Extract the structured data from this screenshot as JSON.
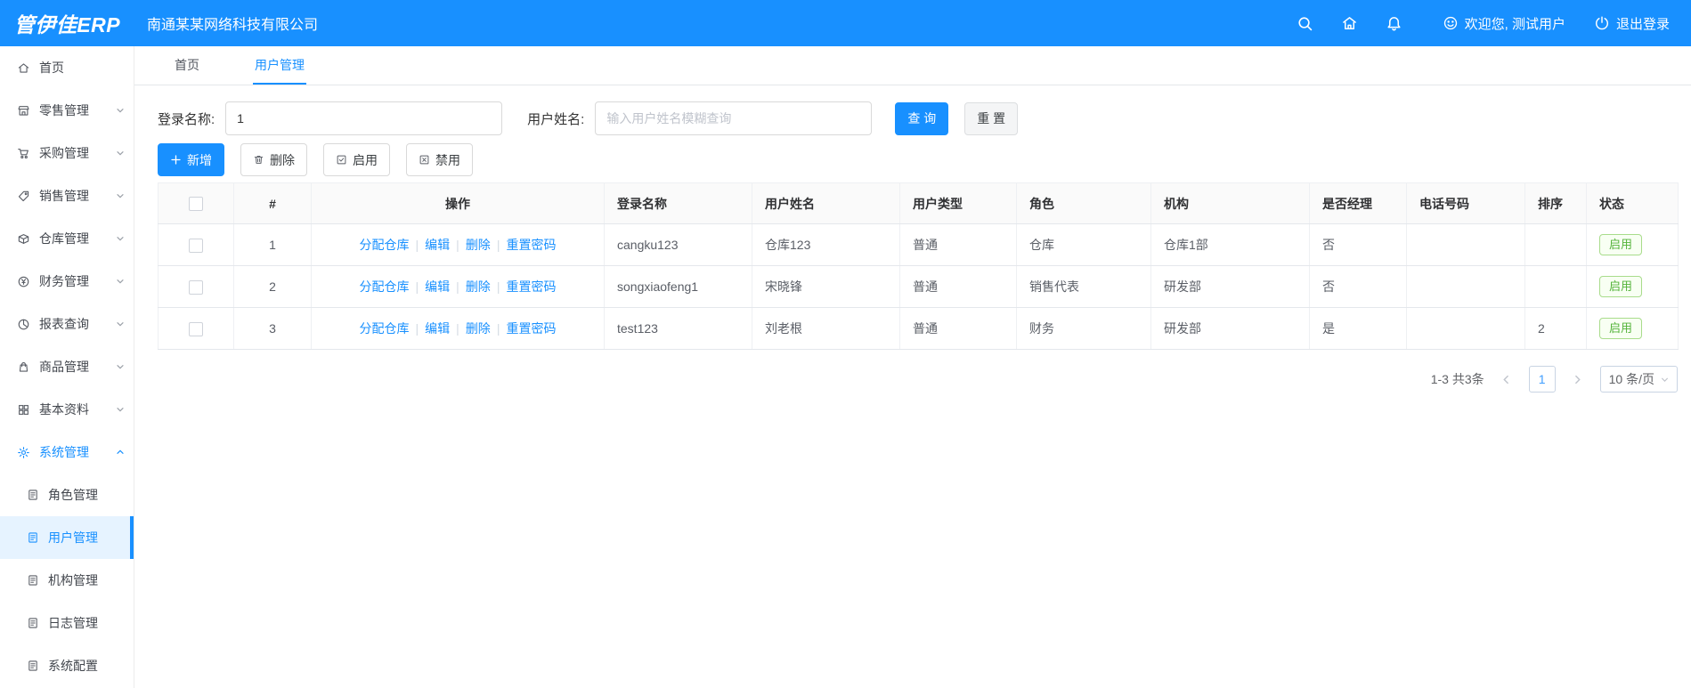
{
  "colors": {
    "primary": "#1890ff",
    "header_bg": "#1890ff",
    "success_green": "#54b33a",
    "active_menu_bg": "#e6f3ff"
  },
  "header": {
    "logo": "管伊佳ERP",
    "company": "南通某某网络科技有限公司",
    "welcome": "欢迎您, 测试用户",
    "logout": "退出登录"
  },
  "sidebar": {
    "items": [
      {
        "label": "首页"
      },
      {
        "label": "零售管理"
      },
      {
        "label": "采购管理"
      },
      {
        "label": "销售管理"
      },
      {
        "label": "仓库管理"
      },
      {
        "label": "财务管理"
      },
      {
        "label": "报表查询"
      },
      {
        "label": "商品管理"
      },
      {
        "label": "基本资料"
      },
      {
        "label": "系统管理"
      },
      {
        "label": "角色管理"
      },
      {
        "label": "用户管理"
      },
      {
        "label": "机构管理"
      },
      {
        "label": "日志管理"
      },
      {
        "label": "系统配置"
      }
    ]
  },
  "tabs": {
    "home": "首页",
    "user_management": "用户管理"
  },
  "search": {
    "login_label": "登录名称:",
    "login_value": "1",
    "name_label": "用户姓名:",
    "name_placeholder": "输入用户姓名模糊查询",
    "query_label": "查 询",
    "reset_label": "重 置"
  },
  "toolbar": {
    "add_label": "新增",
    "delete_label": "删除",
    "enable_label": "启用",
    "disable_label": "禁用"
  },
  "table": {
    "separator": "|",
    "headers": [
      "#",
      "操作",
      "登录名称",
      "用户姓名",
      "用户类型",
      "角色",
      "机构",
      "是否经理",
      "电话号码",
      "排序",
      "状态"
    ],
    "action_links": [
      "分配仓库",
      "编辑",
      "删除",
      "重置密码"
    ],
    "rows": [
      {
        "index": "1",
        "login": "cangku123",
        "name": "仓库123",
        "type": "普通",
        "role": "仓库",
        "org": "仓库1部",
        "manager": "否",
        "phone": "",
        "sort": "",
        "status": "启用"
      },
      {
        "index": "2",
        "login": "songxiaofeng1",
        "name": "宋晓锋",
        "type": "普通",
        "role": "销售代表",
        "org": "研发部",
        "manager": "否",
        "phone": "",
        "sort": "",
        "status": "启用"
      },
      {
        "index": "3",
        "login": "test123",
        "name": "刘老根",
        "type": "普通",
        "role": "财务",
        "org": "研发部",
        "manager": "是",
        "phone": "",
        "sort": "2",
        "status": "启用"
      }
    ]
  },
  "pagination": {
    "total_text": "1-3 共3条",
    "current_page": "1",
    "page_size": "10 条/页"
  }
}
